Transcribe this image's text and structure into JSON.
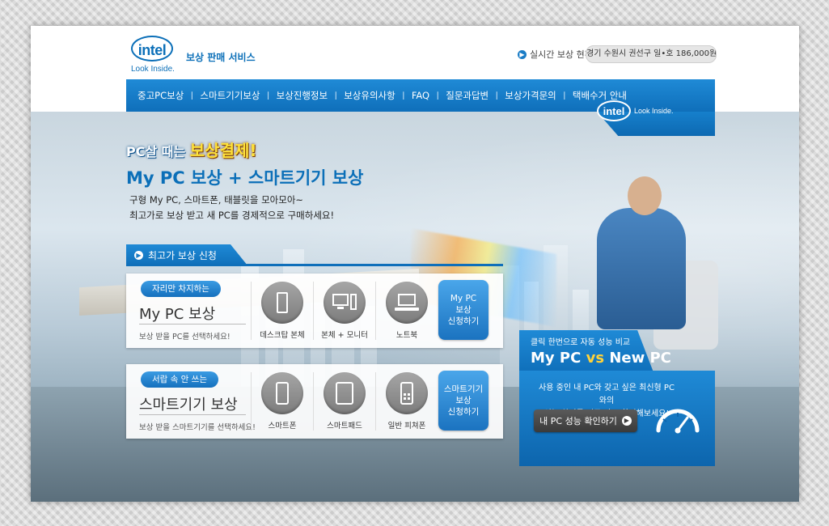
{
  "header": {
    "logo_text": "intel",
    "logo_tagline": "Look Inside.",
    "service_title": "보상 판매 서비스",
    "realtime_label": "실시간 보상 현황",
    "ticker_text": "경기 수원시 권선구 일•호 186,000원"
  },
  "nav": {
    "items": [
      "중고PC보상",
      "스마트기기보상",
      "보상진행정보",
      "보상유의사항",
      "FAQ",
      "질문과답변",
      "보상가격문의",
      "택배수거 안내"
    ],
    "separator": "ㅣ",
    "badge_logo": "intel",
    "badge_tagline": "Look Inside."
  },
  "hero": {
    "slogan_part1": "PC살 때는 ",
    "slogan_highlight": "보상결제!",
    "title": "My PC 보상 + 스마트기기 보상",
    "desc_line1": "구형 My PC, 스마트폰, 태블릿을 모아모아~",
    "desc_line2": "최고가로 보상 받고 새 PC를 경제적으로 구매하세요!"
  },
  "section": {
    "tab_label": "최고가 보상 신청"
  },
  "pc_panel": {
    "pill": "자리만 차지하는",
    "title": "My PC 보상",
    "sub": "보상 받을 PC를 선택하세요!",
    "options": [
      {
        "label": "데스크탑 본체",
        "icon": "desktop-tower-icon"
      },
      {
        "label": "본체 + 모니터",
        "icon": "desktop-monitor-icon"
      },
      {
        "label": "노트북",
        "icon": "laptop-icon"
      }
    ],
    "apply_line1": "My PC",
    "apply_line2": "보상",
    "apply_line3": "신청하기"
  },
  "smart_panel": {
    "pill": "서랍 속 안 쓰는",
    "title": "스마트기기 보상",
    "sub": "보상 받을 스마트기기를 선택하세요!",
    "options": [
      {
        "label": "스마트폰",
        "icon": "smartphone-icon"
      },
      {
        "label": "스마트패드",
        "icon": "tablet-icon"
      },
      {
        "label": "일반 피쳐폰",
        "icon": "feature-phone-icon"
      }
    ],
    "apply_line1": "스마트기기",
    "apply_line2": "보상",
    "apply_line3": "신청하기"
  },
  "compare": {
    "sub": "클릭 한번으로 자동 성능 비교",
    "title_a": "My PC ",
    "title_vs": "vs",
    "title_b": " New PC",
    "desc_line1": "사용 중인 내 PC와 갖고 싶은 최신형 PC와의",
    "desc_line2": "성능 차이를 지금 바로 확인해보세요!",
    "button_label": "내 PC 성능 확인하기"
  },
  "colors": {
    "brand_blue": "#0b6fb8",
    "nav_blue": "#1f8ad6",
    "highlight_yellow": "#ffe23a",
    "vs_yellow": "#ffd23a"
  }
}
